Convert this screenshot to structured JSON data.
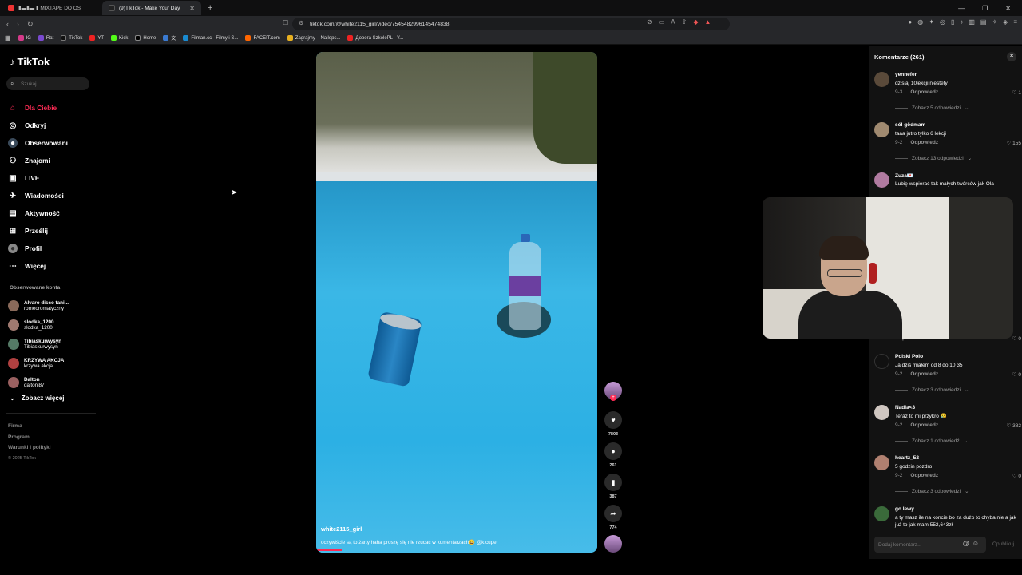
{
  "browser": {
    "tabs": [
      {
        "title": "▮▬▮▬ ▮ MIXTAPE DO OS",
        "active": false
      },
      {
        "title": "(9)TikTok - Make Your Day",
        "active": true
      }
    ],
    "url": "tiktok.com/@white2115_girl/video/7545482996145474838",
    "bookmarks": [
      "IG",
      "Rat",
      "TikTok",
      "YT",
      "Kick",
      "Home",
      "文",
      "Filman.cc - Filmy i S...",
      "FACEIT.com",
      "Zagrajmy – Najleps...",
      "Дорога SzkolePL - Y..."
    ]
  },
  "sidebar": {
    "logo": "TikTok",
    "search_placeholder": "Szukaj",
    "menu": [
      {
        "label": "Dla Ciebie",
        "icon": "home-icon",
        "active": true
      },
      {
        "label": "Odkryj",
        "icon": "compass-icon"
      },
      {
        "label": "Obserwowani",
        "icon": "following-icon"
      },
      {
        "label": "Znajomi",
        "icon": "friends-icon"
      },
      {
        "label": "LIVE",
        "icon": "live-icon"
      },
      {
        "label": "Wiadomości",
        "icon": "messages-icon"
      },
      {
        "label": "Aktywność",
        "icon": "activity-icon"
      },
      {
        "label": "Prześlij",
        "icon": "upload-icon"
      },
      {
        "label": "Profil",
        "icon": "profile-icon"
      },
      {
        "label": "Więcej",
        "icon": "more-icon"
      }
    ],
    "followed_title": "Obserwowane konta",
    "followed": [
      {
        "name": "Alvaro disco tani...",
        "handle": "romeoromatyczny",
        "color": "#8a6a5a"
      },
      {
        "name": "slodka_1200",
        "handle": "slodka_1200",
        "color": "#a07a70"
      },
      {
        "name": "Tibiaskurwysyn",
        "handle": "Tibiaskurwysyn",
        "color": "#557a66"
      },
      {
        "name": "KRZYWA AKCJA",
        "handle": "krzywa.akcja",
        "color": "#b04040"
      },
      {
        "name": "Dalton",
        "handle": "daltoni87",
        "color": "#9a6060"
      }
    ],
    "see_more": "Zobacz więcej",
    "footer": [
      "Firma",
      "Program",
      "Warunki i polityki"
    ],
    "copyright": "© 2025 TikTok"
  },
  "video": {
    "username": "white2115_girl",
    "caption": "oczywiście są to żarty haha proszę się nie rzucać w komentarzach😀 @k.cuper",
    "likes": "7803",
    "comments": "261",
    "saves": "387",
    "shares": "774"
  },
  "comments_panel": {
    "title": "Komentarze (261)",
    "input_placeholder": "Dodaj komentarz...",
    "post_label": "Opublikuj",
    "items": [
      {
        "user": "yennefer",
        "text": "dzisiaj 10lekcji niestety",
        "date": "9-3",
        "reply": "Odpowiedz",
        "likes": "1",
        "more": "Zobacz 5 odpowiedzi",
        "color": "#5a4a3a"
      },
      {
        "user": "sól gödmam",
        "text": "taaa jutro tylko 6 lekcji",
        "date": "9-2",
        "reply": "Odpowiedz",
        "likes": "155",
        "more": "Zobacz 13 odpowiedzi",
        "color": "#a08a70"
      },
      {
        "user": "Zuza💌",
        "text": "Lubię wspierać tak małych twórców jak Ola",
        "date": "",
        "reply": "",
        "likes": "",
        "more": "",
        "color": "#b07aa0"
      },
      {
        "user": "",
        "text": "",
        "date": "9-2",
        "reply": "Odpowiedz",
        "likes": "0",
        "more": "",
        "color": "#333"
      },
      {
        "user": "Polski Polo",
        "text": "Ja dziś miałem od 8 do 10 35",
        "date": "9-2",
        "reply": "Odpowiedz",
        "likes": "0",
        "more": "Zobacz 3 odpowiedzi",
        "color": "#111"
      },
      {
        "user": "Nadia<3",
        "text": "Teraz to mi przykro 😢",
        "date": "9-2",
        "reply": "Odpowiedz",
        "likes": "382",
        "more": "Zobacz 1 odpowiedź",
        "color": "#cfc6c0"
      },
      {
        "user": "heartz_52",
        "text": "5 godzin pozdro",
        "date": "9-2",
        "reply": "Odpowiedz",
        "likes": "0",
        "more": "Zobacz 3 odpowiedzi",
        "color": "#b08070"
      },
      {
        "user": "go.lewy",
        "text": "a ty masz ile na koncie bo za dużo to chyba nie a jak już to jak mam 552,643zł",
        "date": "",
        "reply": "",
        "likes": "",
        "more": "",
        "color": "#3a6a3a"
      }
    ]
  },
  "webcam_overlay_visible": true
}
